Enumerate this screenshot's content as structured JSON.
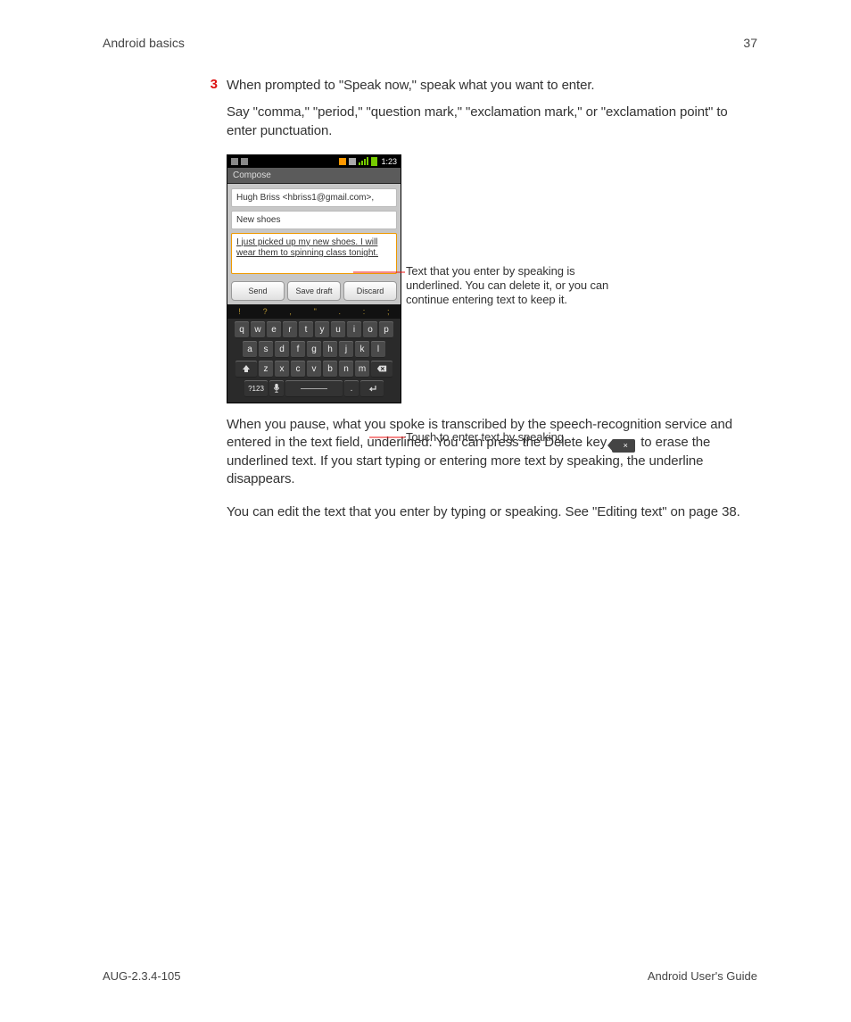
{
  "header": {
    "section": "Android basics",
    "page": "37"
  },
  "step": {
    "num": "3",
    "text": "When prompted to \"Speak now,\" speak what you want to enter."
  },
  "p1": "Say \"comma,\" \"period,\" \"question mark,\" \"exclamation mark,\" or \"exclamation point\" to enter punctuation.",
  "phone": {
    "time": "1:23",
    "compose": "Compose",
    "to": "Hugh Briss <hbriss1@gmail.com>,",
    "subject": "New shoes",
    "body": "I just picked up my new shoes. I will wear them to spinning class tonight.",
    "send": "Send",
    "save": "Save draft",
    "discard": "Discard",
    "hints": [
      "!",
      "?",
      ",",
      "\"",
      ".",
      ":",
      ";"
    ],
    "row1": [
      "q",
      "w",
      "e",
      "r",
      "t",
      "y",
      "u",
      "i",
      "o",
      "p"
    ],
    "row2": [
      "a",
      "s",
      "d",
      "f",
      "g",
      "h",
      "j",
      "k",
      "l"
    ],
    "row3": [
      "z",
      "x",
      "c",
      "v",
      "b",
      "n",
      "m"
    ],
    "sym": "?123",
    "dot": "."
  },
  "anno1": "Text that you enter by speaking is underlined. You can delete it, or you can continue entering text to keep it.",
  "anno2": "Touch to enter text by speaking.",
  "p2a": "When you pause, what you spoke is transcribed by the speech-recognition service and entered in the text field, underlined. You can press the Delete key ",
  "p2b": " to erase the underlined text. If you start typing or entering more text by speaking, the underline disappears.",
  "p3": "You can edit the text that you enter by typing or speaking. See \"Editing text\" on page 38.",
  "footer": {
    "left": "AUG-2.3.4-105",
    "right": "Android User's Guide"
  },
  "delglyph": "×"
}
